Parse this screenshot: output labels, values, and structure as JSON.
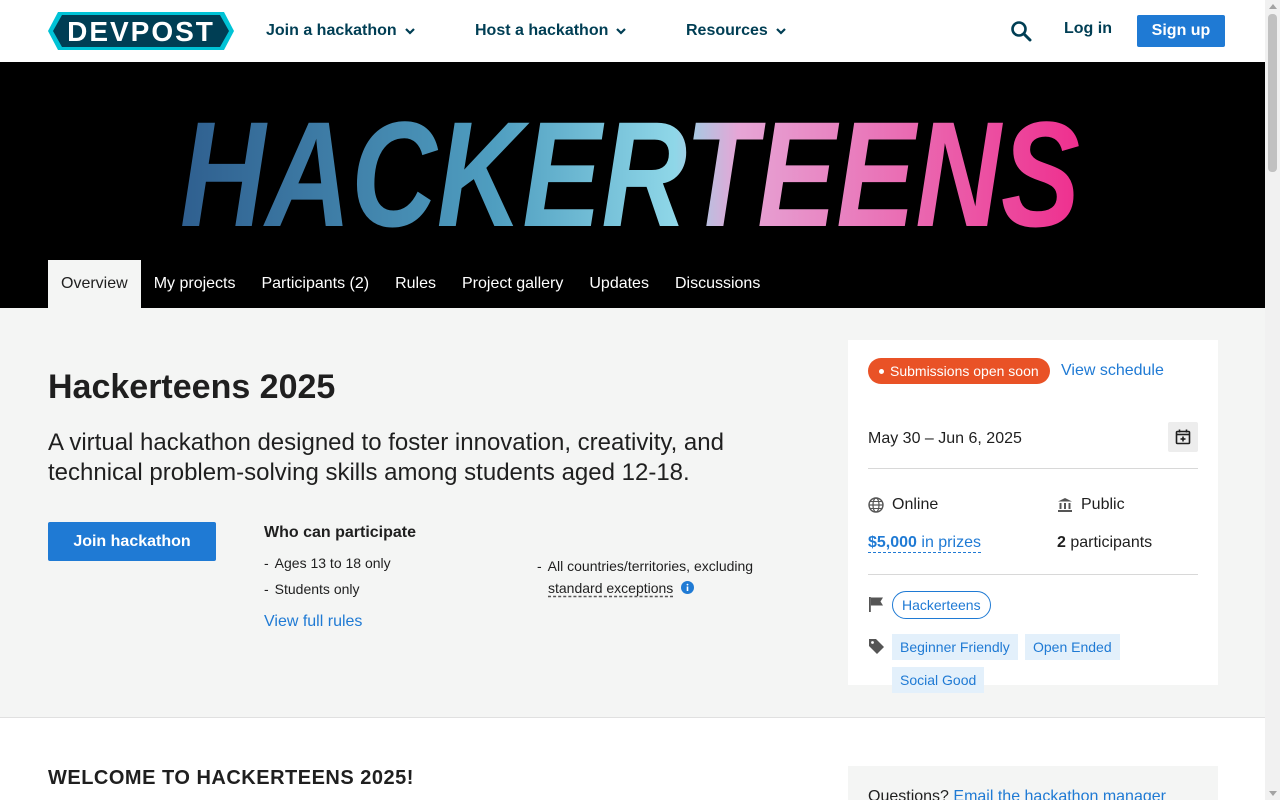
{
  "brand": {
    "logo_text": "DEVPOST",
    "accent": "#1f7ad4",
    "dark": "#003e54",
    "badge_color": "#e95226"
  },
  "nav": {
    "items": [
      {
        "label": "Join a hackathon"
      },
      {
        "label": "Host a hackathon"
      },
      {
        "label": "Resources"
      }
    ],
    "login": "Log in",
    "signup": "Sign up"
  },
  "banner": {
    "logo_text": "HACKERTEENS"
  },
  "tabs": [
    {
      "label": "Overview",
      "active": true
    },
    {
      "label": "My projects"
    },
    {
      "label": "Participants (2)"
    },
    {
      "label": "Rules"
    },
    {
      "label": "Project gallery"
    },
    {
      "label": "Updates"
    },
    {
      "label": "Discussions"
    }
  ],
  "hackathon": {
    "title": "Hackerteens 2025",
    "tagline": "A virtual hackathon designed to foster innovation, creativity, and technical problem-solving skills among students aged 12-18.",
    "join_label": "Join hackathon",
    "who_title": "Who can participate",
    "eligibility": [
      "Ages 13 to 18 only",
      "Students only",
      "All countries/territories, excluding"
    ],
    "exceptions_link": "standard exceptions",
    "full_rules": "View full rules"
  },
  "sidebar": {
    "status": "Submissions open soon",
    "view_schedule": "View schedule",
    "dates": "May 30 – Jun 6, 2025",
    "location": "Online",
    "visibility": "Public",
    "prize_amount": "$5,000",
    "prize_suffix": " in prizes",
    "participants_count": "2",
    "participants_suffix": " participants",
    "host_pill": "Hackerteens",
    "tags": [
      "Beginner Friendly",
      "Open Ended",
      "Social Good"
    ]
  },
  "lower": {
    "welcome": "WELCOME TO HACKERTEENS 2025!",
    "questions_prefix": "Questions? ",
    "questions_link": "Email the hackathon manager"
  }
}
